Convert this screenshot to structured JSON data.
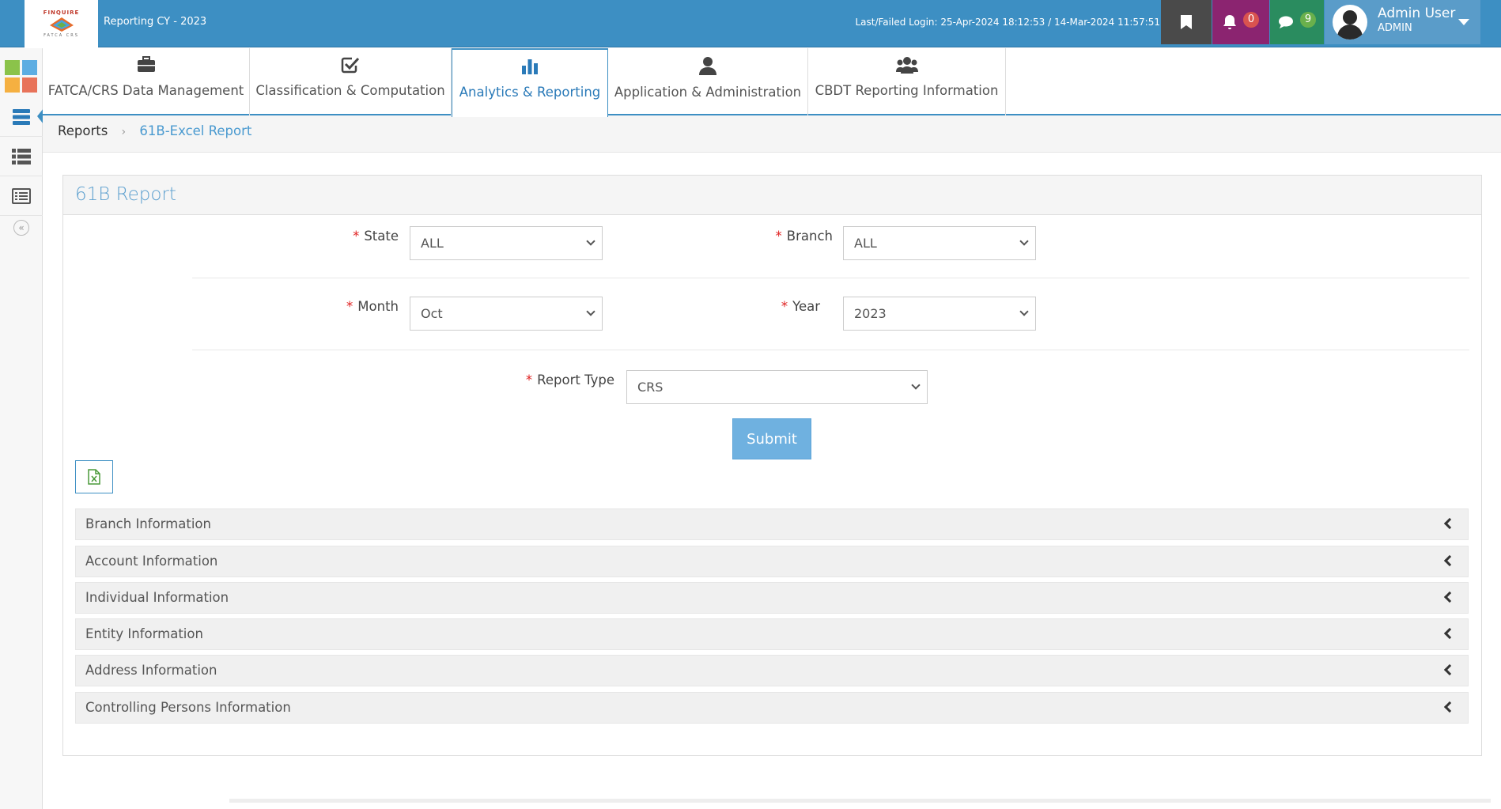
{
  "header": {
    "reporting_label": "Reporting CY - 2023",
    "last_login": "Last/Failed Login: 25-Apr-2024 18:12:53 / 14-Mar-2024 11:57:51",
    "notifications_count": "0",
    "messages_count": "9",
    "user_name": "Admin User",
    "user_role": "ADMIN",
    "colors": {
      "bar": "#3d8fc3",
      "bookmark": "#4a4a4a",
      "bell": "#8b2470",
      "chat": "#2a8c5f"
    }
  },
  "logo": {
    "top_text": "FINQUIRE",
    "bottom_text": "FATCA CRS"
  },
  "sidebar": {
    "items": [
      {
        "icon": "apps-grid-icon"
      },
      {
        "icon": "server-stack-icon",
        "active": true
      },
      {
        "icon": "list-icon"
      },
      {
        "icon": "list-alt-icon"
      },
      {
        "icon": "collapse-icon"
      }
    ]
  },
  "tabs": [
    {
      "label": "FATCA/CRS Data Management",
      "icon": "briefcase-icon"
    },
    {
      "label": "Classification & Computation",
      "icon": "check-square-icon"
    },
    {
      "label": "Analytics & Reporting",
      "icon": "bar-chart-icon",
      "active": true
    },
    {
      "label": "Application & Administration",
      "icon": "user-icon"
    },
    {
      "label": "CBDT Reporting Information",
      "icon": "users-icon"
    }
  ],
  "breadcrumb": {
    "root": "Reports",
    "current": "61B-Excel Report"
  },
  "panel": {
    "title": "61B Report"
  },
  "form": {
    "state": {
      "label": "State",
      "value": "ALL"
    },
    "branch": {
      "label": "Branch",
      "value": "ALL"
    },
    "month": {
      "label": "Month",
      "value": "Oct"
    },
    "year": {
      "label": "Year",
      "value": "2023"
    },
    "report_type": {
      "label": "Report Type",
      "value": "CRS"
    },
    "required_mark": "*",
    "submit_label": "Submit"
  },
  "accordion": [
    "Branch Information",
    "Account Information",
    "Individual Information",
    "Entity Information",
    "Address Information",
    "Controlling Persons Information"
  ]
}
